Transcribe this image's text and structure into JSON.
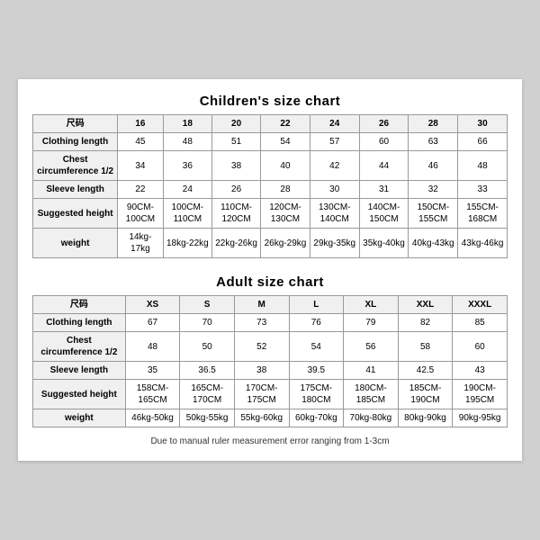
{
  "children_title": "Children's size chart",
  "adult_title": "Adult size chart",
  "note": "Due to manual ruler measurement error ranging from 1-3cm",
  "children": {
    "headers": [
      "尺码",
      "16",
      "18",
      "20",
      "22",
      "24",
      "26",
      "28",
      "30"
    ],
    "rows": [
      {
        "label": "Clothing length",
        "values": [
          "45",
          "48",
          "51",
          "54",
          "57",
          "60",
          "63",
          "66"
        ]
      },
      {
        "label": "Chest circumference 1/2",
        "values": [
          "34",
          "36",
          "38",
          "40",
          "42",
          "44",
          "46",
          "48"
        ]
      },
      {
        "label": "Sleeve length",
        "values": [
          "22",
          "24",
          "26",
          "28",
          "30",
          "31",
          "32",
          "33"
        ]
      },
      {
        "label": "Suggested height",
        "values": [
          "90CM-100CM",
          "100CM-110CM",
          "110CM-120CM",
          "120CM-130CM",
          "130CM-140CM",
          "140CM-150CM",
          "150CM-155CM",
          "155CM-168CM"
        ]
      },
      {
        "label": "weight",
        "values": [
          "14kg-17kg",
          "18kg-22kg",
          "22kg-26kg",
          "26kg-29kg",
          "29kg-35kg",
          "35kg-40kg",
          "40kg-43kg",
          "43kg-46kg"
        ]
      }
    ]
  },
  "adult": {
    "headers": [
      "尺码",
      "XS",
      "S",
      "M",
      "L",
      "XL",
      "XXL",
      "XXXL"
    ],
    "rows": [
      {
        "label": "Clothing length",
        "values": [
          "67",
          "70",
          "73",
          "76",
          "79",
          "82",
          "85"
        ]
      },
      {
        "label": "Chest circumference 1/2",
        "values": [
          "48",
          "50",
          "52",
          "54",
          "56",
          "58",
          "60"
        ]
      },
      {
        "label": "Sleeve length",
        "values": [
          "35",
          "36.5",
          "38",
          "39.5",
          "41",
          "42.5",
          "43"
        ]
      },
      {
        "label": "Suggested height",
        "values": [
          "158CM-165CM",
          "165CM-170CM",
          "170CM-175CM",
          "175CM-180CM",
          "180CM-185CM",
          "185CM-190CM",
          "190CM-195CM"
        ]
      },
      {
        "label": "weight",
        "values": [
          "46kg-50kg",
          "50kg-55kg",
          "55kg-60kg",
          "60kg-70kg",
          "70kg-80kg",
          "80kg-90kg",
          "90kg-95kg"
        ]
      }
    ]
  }
}
